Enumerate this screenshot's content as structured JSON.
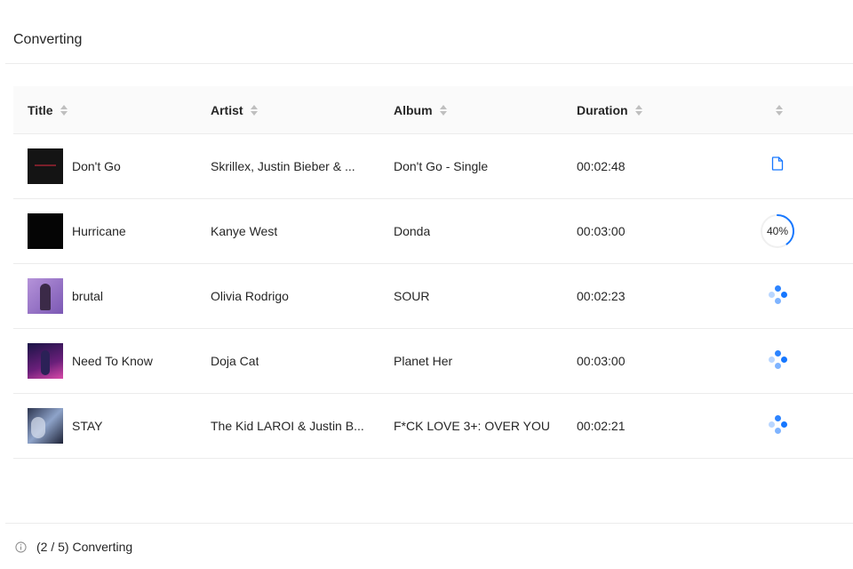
{
  "header": {
    "title": "Converting"
  },
  "table": {
    "columns": [
      {
        "key": "title",
        "label": "Title"
      },
      {
        "key": "artist",
        "label": "Artist"
      },
      {
        "key": "album",
        "label": "Album"
      },
      {
        "key": "duration",
        "label": "Duration"
      },
      {
        "key": "status",
        "label": ""
      }
    ],
    "rows": [
      {
        "title": "Don't Go",
        "artist": "Skrillex, Justin Bieber & ...",
        "album": "Don't Go - Single",
        "duration": "00:02:48",
        "status": "done",
        "status_icon": "file-icon"
      },
      {
        "title": "Hurricane",
        "artist": "Kanye West",
        "album": "Donda",
        "duration": "00:03:00",
        "status": "converting",
        "progress": 40,
        "progress_label": "40%"
      },
      {
        "title": "brutal",
        "artist": "Olivia Rodrigo",
        "album": "SOUR",
        "duration": "00:02:23",
        "status": "waiting",
        "status_icon": "loading-dots-icon"
      },
      {
        "title": "Need To Know",
        "artist": "Doja Cat",
        "album": "Planet Her",
        "duration": "00:03:00",
        "status": "waiting",
        "status_icon": "loading-dots-icon"
      },
      {
        "title": "STAY",
        "artist": "The Kid LAROI & Justin B...",
        "album": "F*CK LOVE 3+: OVER YOU",
        "duration": "00:02:21",
        "status": "waiting",
        "status_icon": "loading-dots-icon"
      }
    ]
  },
  "footer": {
    "status_text": "(2 / 5) Converting",
    "icon": "info-icon"
  },
  "colors": {
    "accent": "#1677ff",
    "border": "#ececec",
    "header_bg": "#fafafa",
    "text": "#262626",
    "sorter": "#bfbfbf"
  }
}
